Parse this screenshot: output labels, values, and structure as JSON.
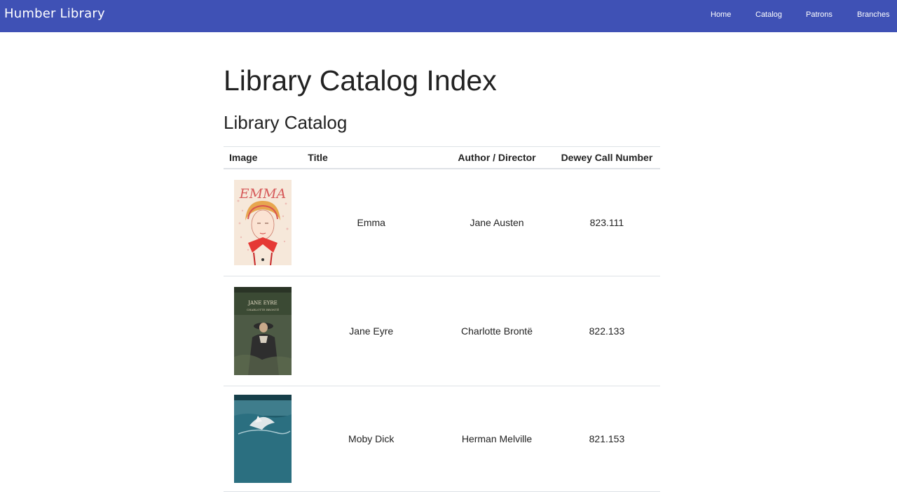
{
  "navbar": {
    "brand": "Humber Library",
    "links": [
      "Home",
      "Catalog",
      "Patrons",
      "Branches"
    ]
  },
  "main": {
    "page_title": "Library Catalog Index",
    "section_title": "Library Catalog",
    "table": {
      "headers": [
        "Image",
        "Title",
        "Author / Director",
        "Dewey Call Number"
      ],
      "rows": [
        {
          "cover_text": "EMMA",
          "title": "Emma",
          "author": "Jane Austen",
          "dewey": "823.111"
        },
        {
          "cover_text": "JANE EYRE",
          "cover_subtext": "CHARLOTTE BRONTË",
          "title": "Jane Eyre",
          "author": "Charlotte Brontë",
          "dewey": "822.133"
        },
        {
          "title": "Moby Dick",
          "author": "Herman Melville",
          "dewey": "821.153"
        }
      ]
    }
  },
  "colors": {
    "navbar": "#3f51b5",
    "text": "#222222",
    "border": "#dee2e6"
  }
}
